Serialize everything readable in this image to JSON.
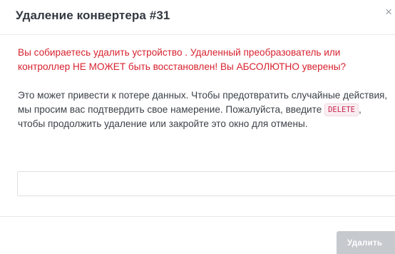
{
  "modal": {
    "title": "Удаление конвертера #31",
    "close_glyph": "×",
    "warning": "Вы собираетесь удалить устройство . Удаленный преобразователь или контроллер НЕ МОЖЕТ быть восстановлен! Вы АБСОЛЮТНО уверены?",
    "instruction_before": "Это может привести к потере данных. Чтобы предотвратить случайные действия, мы просим вас подтвердить свое намерение. Пожалуйста, введите ",
    "confirm_keyword": "DELETE",
    "instruction_after": ", чтобы продолжить удаление или закройте это окно для отмены.",
    "input": {
      "value": "",
      "placeholder": ""
    },
    "delete_button_label": "Удалить"
  },
  "colors": {
    "warning": "#d8222f",
    "text": "#3d4148",
    "button_disabled": "#c6c9cd"
  },
  "icons": {
    "close": "close-icon"
  }
}
